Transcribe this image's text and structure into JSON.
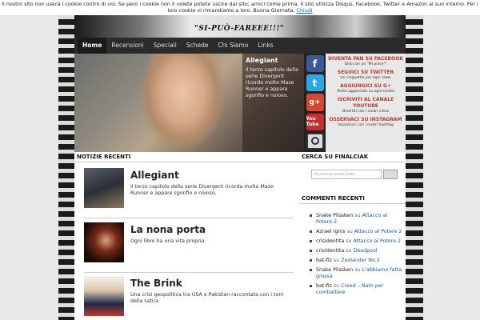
{
  "cookie": {
    "text": "Il nostro sito non userà i cookie contro di voi. Se però i cookie non li volete potete uscire dal sito; amici come prima. Il sito utilizza Disqus, Facebook, Twitter e Amazon al suo interno. Per i loro cookie vi rimandiamo a loro. Buona Giornata.",
    "close_label": "Chiudi"
  },
  "header": {
    "tagline": "\"SI-PUÒ-FAREEE!!!\""
  },
  "nav": {
    "items": [
      "Home",
      "Recensioni",
      "Speciali",
      "Schede",
      "Chi Siamo",
      "Links"
    ]
  },
  "slider": {
    "title": "Allegiant",
    "text": "Il terzo capitolo della serie Divergent ricorda molto Maze Runner e appare sgonfio e noioso."
  },
  "social": [
    {
      "icon": "facebook-icon",
      "glyph": "f",
      "head": "DIVENTA FAN SU FACEBOOK",
      "sub": "Dillo con un \"Mi piace\"!"
    },
    {
      "icon": "twitter-icon",
      "glyph": "t",
      "head": "SEGUICI SU TWITTER",
      "sub": "Un cinguettio per ogni news"
    },
    {
      "icon": "googleplus-icon",
      "glyph": "g+",
      "head": "AGGIUNGICI SU G+",
      "sub": "Resta aggiornato su ogni novità"
    },
    {
      "icon": "youtube-icon",
      "glyph": "You Tube",
      "head": "ISCRIVITI AL CANALE YOUTUBE",
      "sub": "Divertiti con i nostri video"
    },
    {
      "icon": "instagram-icon",
      "glyph": "",
      "head": "OSSERVACI SU INSTAGRAM",
      "sub": "Impazzisci con i nostri hashtag"
    }
  ],
  "main": {
    "section_title": "NOTIZIE RECENTI",
    "posts": [
      {
        "title": "Allegiant",
        "excerpt": "Il terzo capitolo della serie Divergent ricorda molto Maze Runner e appare sgonfio e noioso."
      },
      {
        "title": "La nona porta",
        "excerpt": "Ogni libro ha una vita propria."
      },
      {
        "title": "The Brink",
        "excerpt": "Una crisi geopolitica tra USA e Pakistan raccontata con i toni della satira"
      }
    ]
  },
  "sidebar": {
    "search_title": "CERCA SU FINALCIAK",
    "search_placeholder": "Ricerca personalizzata",
    "search_button": "",
    "comments_title": "COMMENTI RECENTI",
    "su": "su",
    "comments": [
      {
        "author": "Snake Plissken",
        "post": "Attacco al Potere 2"
      },
      {
        "author": "Azrael Ignis",
        "post": "Attacco al Potere 2"
      },
      {
        "author": "crisidentita",
        "post": "Attacco al Potere 2"
      },
      {
        "author": "crisidentita",
        "post": "Deadpool"
      },
      {
        "author": "bat-fiz",
        "post": "Zoolander No.2"
      },
      {
        "author": "Snake Plissken",
        "post": "L'abbiamo fatta grossa"
      },
      {
        "author": "bat-fiz",
        "post": "Creed – Nato per combattere"
      }
    ]
  }
}
